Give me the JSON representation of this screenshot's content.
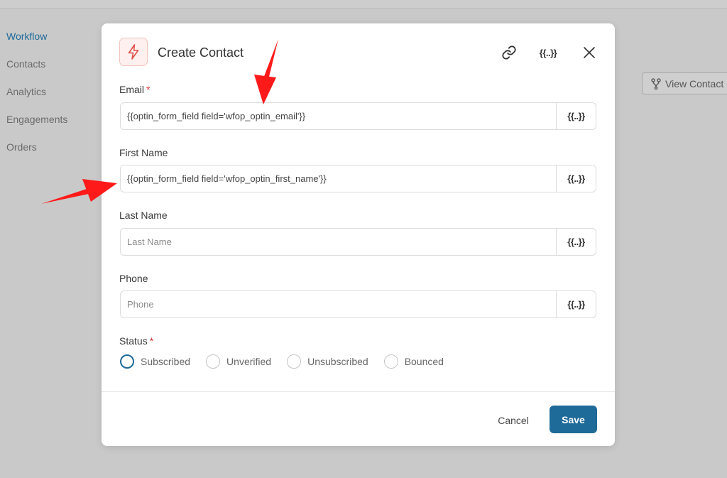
{
  "sidebar": {
    "items": [
      {
        "label": "Workflow",
        "active": true
      },
      {
        "label": "Contacts"
      },
      {
        "label": "Analytics"
      },
      {
        "label": "Engagements"
      },
      {
        "label": "Orders"
      }
    ]
  },
  "background": {
    "view_contact_label": "View Contact"
  },
  "modal": {
    "title": "Create Contact",
    "merge_tag_label": "{{..}}",
    "header_icon": "lightning-bolt-icon",
    "fields": {
      "email": {
        "label": "Email",
        "required": "*",
        "value": "{{optin_form_field field='wfop_optin_email'}}",
        "placeholder": ""
      },
      "first_name": {
        "label": "First Name",
        "value": "{{optin_form_field field='wfop_optin_first_name'}}",
        "placeholder": ""
      },
      "last_name": {
        "label": "Last Name",
        "value": "",
        "placeholder": "Last Name"
      },
      "phone": {
        "label": "Phone",
        "value": "",
        "placeholder": "Phone"
      }
    },
    "status": {
      "label": "Status",
      "required": "*",
      "options": [
        "Subscribed",
        "Unverified",
        "Unsubscribed",
        "Bounced"
      ],
      "selected": "Subscribed"
    },
    "footer": {
      "cancel_label": "Cancel",
      "save_label": "Save"
    }
  },
  "colors": {
    "accent": "#1e6a99",
    "required": "#d63638",
    "annotation_arrow": "#ff1a1a"
  }
}
